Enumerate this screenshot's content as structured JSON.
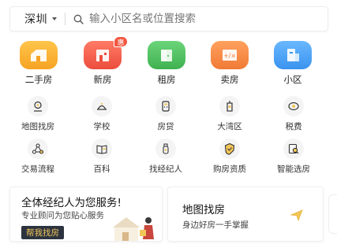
{
  "search": {
    "city": "深圳",
    "placeholder": "输入小区名或位置搜索"
  },
  "main_categories": [
    {
      "label": "二手房",
      "icon": "second-hand-house-icon",
      "color": "#f5a623"
    },
    {
      "label": "新房",
      "icon": "new-house-icon",
      "color": "#f0604d",
      "badge": "惠"
    },
    {
      "label": "租房",
      "icon": "rent-icon",
      "color": "#4fbf5f"
    },
    {
      "label": "卖房",
      "icon": "sell-house-icon",
      "color": "#f58a42"
    },
    {
      "label": "小区",
      "icon": "community-icon",
      "color": "#3b9cf0"
    }
  ],
  "small_categories_row1": [
    {
      "label": "地图找房",
      "icon": "map-search-icon"
    },
    {
      "label": "学校",
      "icon": "school-icon"
    },
    {
      "label": "房贷",
      "icon": "mortgage-icon"
    },
    {
      "label": "大湾区",
      "icon": "greater-bay-area-icon"
    },
    {
      "label": "税费",
      "icon": "tax-icon"
    }
  ],
  "small_categories_row2": [
    {
      "label": "交易流程",
      "icon": "transaction-flow-icon"
    },
    {
      "label": "百科",
      "icon": "encyclopedia-icon"
    },
    {
      "label": "找经纪人",
      "icon": "find-agent-icon"
    },
    {
      "label": "购房资质",
      "icon": "purchase-qualification-icon"
    },
    {
      "label": "智能选房",
      "icon": "smart-select-icon"
    }
  ],
  "cards": {
    "agent": {
      "title": "全体经纪人为您服务!",
      "subtitle": "专业顾问为您贴心服务",
      "cta": "帮我找房"
    },
    "map": {
      "title": "地图找房",
      "subtitle": "身边好房一手掌握"
    }
  },
  "colors": {
    "accent_yellow": "#f3c65a",
    "cta_bg": "#2d3440"
  }
}
